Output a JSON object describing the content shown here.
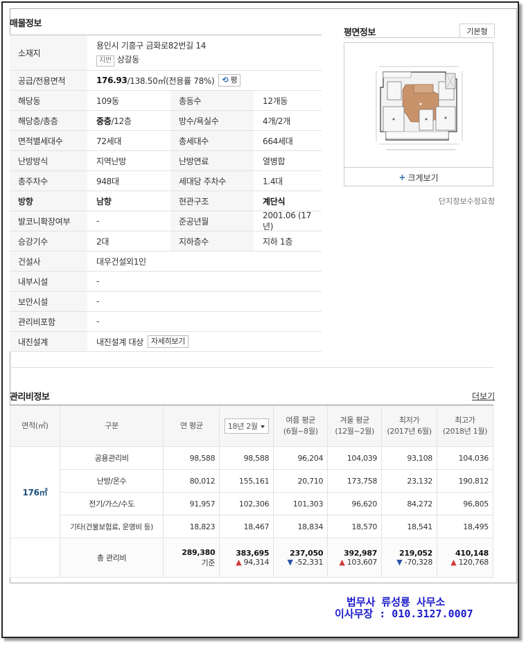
{
  "sections": {
    "property_title": "매물정보",
    "floorplan_title": "평면정보",
    "management_title": "관리비정보"
  },
  "floorplan": {
    "tab_label": "기본형",
    "enlarge_label": "크게보기",
    "report_link": "단지정보수정요청"
  },
  "address": {
    "label": "소재지",
    "road": "용인시 기흥구 금화로82번길 14",
    "lot_tag": "지번",
    "lot": "상갈동"
  },
  "area": {
    "label": "공급/전용면적",
    "supply": "176.93",
    "rest": "/138.50㎡(전용률 78%)",
    "unit_button": "평"
  },
  "rows": [
    {
      "l1": "해당동",
      "v1": "109동",
      "l2": "총동수",
      "v2": "12개동"
    },
    {
      "l1": "해당층/총층",
      "v1a": "중층",
      "v1b": "/12층",
      "l2": "방수/욕실수",
      "v2": "4개/2개"
    },
    {
      "l1": "면적별세대수",
      "v1": "72세대",
      "l2": "총세대수",
      "v2": "664세대"
    },
    {
      "l1": "난방방식",
      "v1": "지역난방",
      "l2": "난방연료",
      "v2": "열병합"
    },
    {
      "l1": "총주차수",
      "v1": "948대",
      "l2": "세대당 주차수",
      "v2": "1.4대"
    },
    {
      "l1": "방향",
      "v1": "남향",
      "l2": "현관구조",
      "v2": "계단식"
    },
    {
      "l1": "발코니확장여부",
      "v1": "-",
      "l2": "준공년월",
      "v2": "2001.06 (17년)"
    },
    {
      "l1": "승강기수",
      "v1": "2대",
      "l2": "지하층수",
      "v2": "지하 1층"
    }
  ],
  "wide_rows": [
    {
      "label": "건설사",
      "value": "대우건설외1인"
    },
    {
      "label": "내부시설",
      "value": "-"
    },
    {
      "label": "보안시설",
      "value": "-"
    },
    {
      "label": "관리비포함",
      "value": "-"
    }
  ],
  "seismic": {
    "label": "내진설계",
    "value": "내진설계 대상",
    "button": "자세히보기"
  },
  "management": {
    "more_link": "더보기",
    "headers": {
      "area": "면적(㎡)",
      "category": "구분",
      "annual_avg": "연 평균",
      "month_select": "18년 2월",
      "summer": "여름 평균",
      "summer_sub": "(6월~8월)",
      "winter": "겨울 평균",
      "winter_sub": "(12월~2월)",
      "min": "최저가",
      "min_sub": "(2017년 6월)",
      "max": "최고가",
      "max_sub": "(2018년 1월)"
    },
    "area_value": "176㎡",
    "rows": [
      {
        "name": "공용관리비",
        "vals": [
          "98,588",
          "98,588",
          "96,204",
          "104,039",
          "93,108",
          "104,036"
        ]
      },
      {
        "name": "난방/온수",
        "vals": [
          "80,012",
          "155,161",
          "20,710",
          "173,758",
          "23,132",
          "190,812"
        ]
      },
      {
        "name": "전기/가스/수도",
        "vals": [
          "91,957",
          "102,306",
          "101,303",
          "96,620",
          "84,272",
          "96,805"
        ]
      },
      {
        "name": "기타(건물보험료, 운영비 등)",
        "vals": [
          "18,823",
          "18,467",
          "18,834",
          "18,570",
          "18,541",
          "18,495"
        ]
      }
    ],
    "total": {
      "name": "총 관리비",
      "annual": "289,380",
      "annual_sub": "기준",
      "month": "383,695",
      "month_diff": "94,314",
      "summer": "237,050",
      "summer_diff": "-52,331",
      "winter": "392,987",
      "winter_diff": "103,607",
      "min": "219,052",
      "min_diff": "-70,328",
      "max": "410,148",
      "max_diff": "120,768"
    }
  },
  "footer": {
    "line1": "법무사 류성룡 사무소",
    "line2": "이사무장 : 010.3127.0007"
  }
}
